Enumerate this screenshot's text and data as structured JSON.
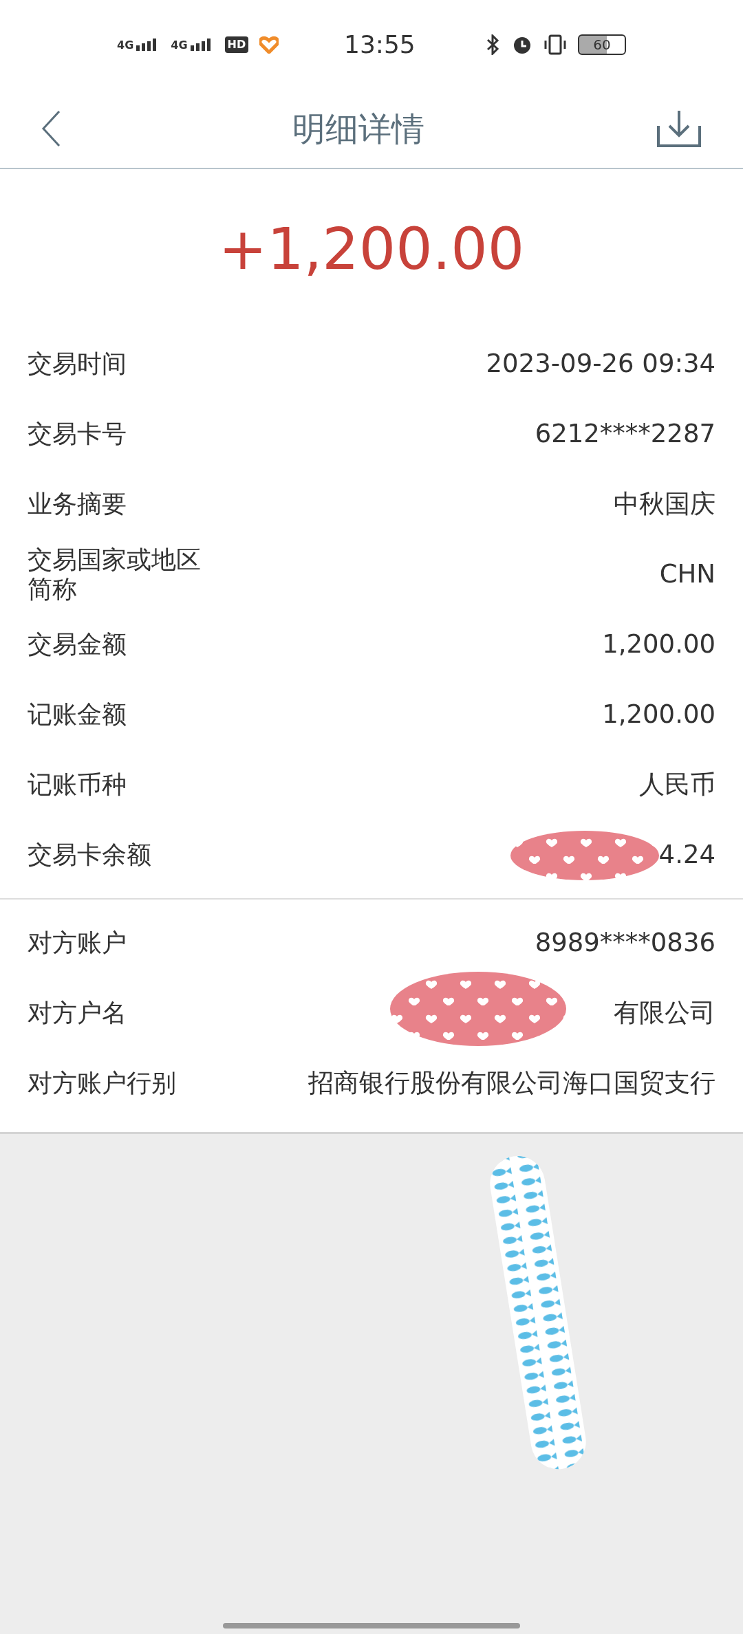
{
  "status_bar": {
    "networks": [
      "4G",
      "4G"
    ],
    "hd": "HD",
    "time": "13:55",
    "battery": "60"
  },
  "header": {
    "title": "明细详情"
  },
  "amount": "+1,200.00",
  "details": [
    {
      "label": "交易时间",
      "value": "2023-09-26 09:34"
    },
    {
      "label": "交易卡号",
      "value": "6212****2287"
    },
    {
      "label": "业务摘要",
      "value": "中秋国庆"
    },
    {
      "label": "交易国家或地区简称",
      "value": "CHN"
    },
    {
      "label": "交易金额",
      "value": "1,200.00"
    },
    {
      "label": "记账金额",
      "value": "1,200.00"
    },
    {
      "label": "记账币种",
      "value": "人民币"
    },
    {
      "label": "交易卡余额",
      "value": "4.24"
    }
  ],
  "counterparty": [
    {
      "label": "对方账户",
      "value": "8989****0836"
    },
    {
      "label": "对方户名",
      "value": "有限公司"
    },
    {
      "label": "对方账户行别",
      "value": "招商银行股份有限公司海口国贸支行"
    }
  ]
}
